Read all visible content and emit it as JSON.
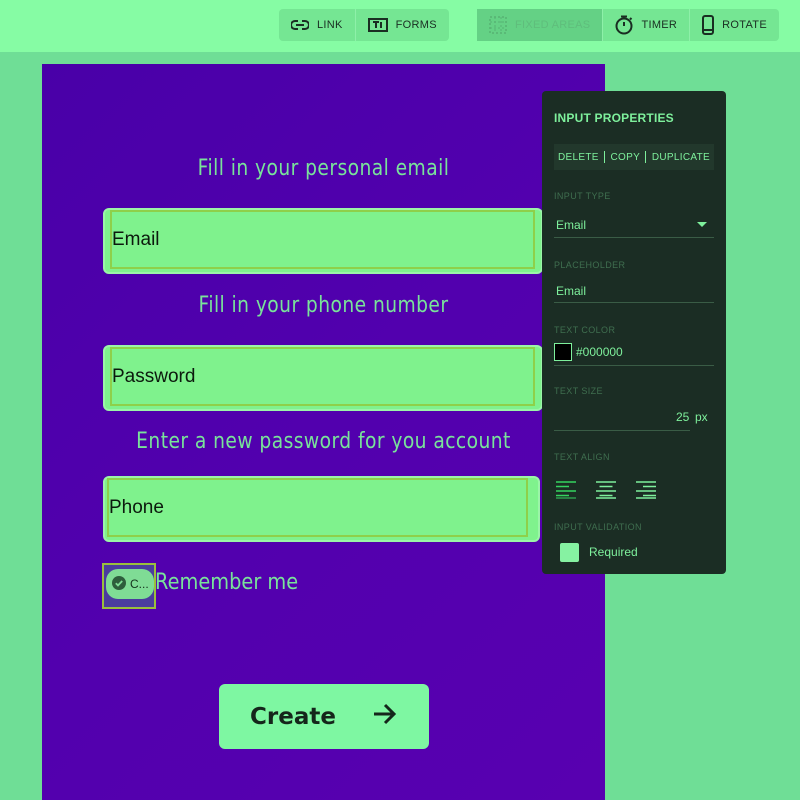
{
  "toolbar": {
    "link": "LINK",
    "forms": "FORMS",
    "fixed_areas": "FIXED AREAS",
    "timer": "TIMER",
    "rotate": "ROTATE"
  },
  "form": {
    "label_email": "Fill in your personal email",
    "email_placeholder": "Email",
    "label_phone": "Fill in your phone number",
    "password_placeholder": "Password",
    "label_password": "Enter a new password for you account",
    "phone_placeholder": "Phone",
    "checkbox_chip": "C...",
    "remember_label": "Remember me",
    "create_button": "Create"
  },
  "panel": {
    "title": "INPUT PROPERTIES",
    "delete": "DELETE",
    "copy": "COPY",
    "duplicate": "DUPLICATE",
    "input_type_label": "INPUT TYPE",
    "input_type_value": "Email",
    "placeholder_label": "PLACEHOLDER",
    "placeholder_value": "Email",
    "text_color_label": "TEXT COLOR",
    "text_color_value": "#000000",
    "text_size_label": "TEXT SIZE",
    "text_size_value": "25",
    "text_size_unit": "px",
    "text_align_label": "TEXT ALIGN",
    "validation_label": "INPUT VALIDATION",
    "required_label": "Required"
  },
  "colors": {
    "background": "#6fde96",
    "toolbar": "#86fca4",
    "canvas": "#4e00ab",
    "accent": "#7ef09c",
    "panel": "#1b2d24"
  }
}
